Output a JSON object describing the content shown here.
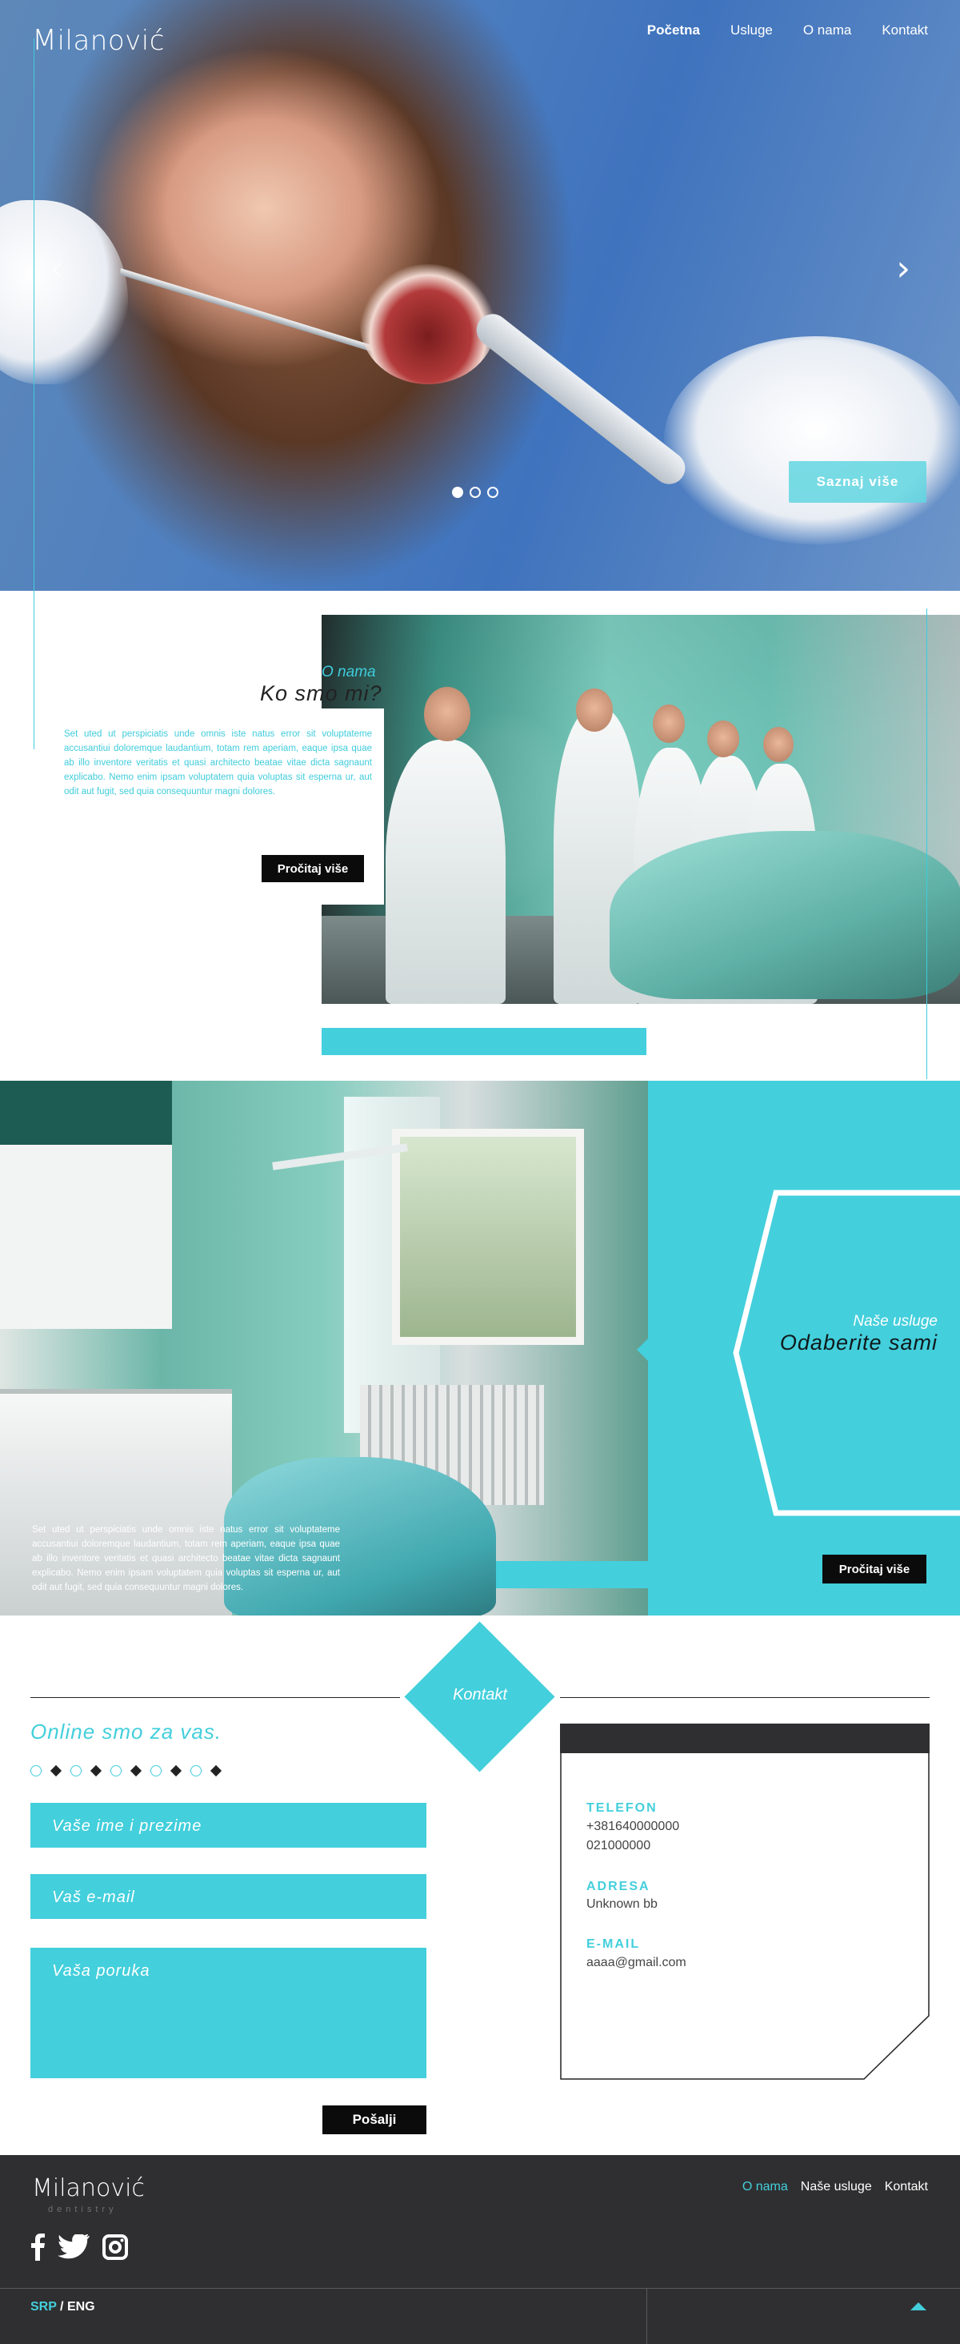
{
  "brand": {
    "logo_text": "ilanović",
    "logo_initial": "M",
    "tagline": "dentistry"
  },
  "nav": {
    "items": [
      "Početna",
      "Usluge",
      "O nama",
      "Kontakt"
    ],
    "active": "Početna"
  },
  "hero": {
    "prev_arrow": "‹",
    "next_arrow": "›",
    "cta": "Saznaj više",
    "slides": 3,
    "active_slide": 1
  },
  "about": {
    "subtitle": "O nama",
    "title": "Ko smo mi?",
    "text": "Set uted ut perspiciatis unde omnis iste natus error sit voluptateme accusantiui doloremque laudantium, totam rem aperiam, eaque ipsa quae ab illo inventore veritatis et quasi architecto beatae vitae dicta sagnaunt explicabo. Nemo enim ipsam voluptatem quia voluptas sit esperna ur, aut odit aut fugit, sed quia consequuntur magni dolores.",
    "button": "Pročitaj više"
  },
  "services": {
    "subtitle": "Naše usluge",
    "title": "Odaberite sami",
    "text": "Set uted ut perspiciatis unde omnis iste natus error sit voluptateme accusantiui doloremque laudantium, totam rem aperiam, eaque ipsa quae ab illo inventore veritatis et quasi architecto beatae vitae dicta sagnaunt explicabo. Nemo enim ipsam voluptatem quia voluptas sit esperna ur, aut odit aut fugit, sed quia consequuntur magni dolores.",
    "button": "Pročitaj više"
  },
  "contact": {
    "heading": "Kontakt",
    "online": "Online smo za vas.",
    "form": {
      "name_placeholder": "Vaše ime i prezime",
      "email_placeholder": "Vaš e-mail",
      "message_placeholder": "Vaša poruka",
      "send": "Pošalji"
    },
    "card": {
      "phone_label": "TELEFON",
      "phone_1": "+381640000000",
      "phone_2": "021000000",
      "address_label": "ADRESA",
      "address": "Unknown bb",
      "email_label": "E-MAIL",
      "email": "aaaa@gmail.com"
    }
  },
  "footer": {
    "nav": [
      "O nama",
      "Naše usluge",
      "Kontakt"
    ],
    "active": "O nama",
    "social": [
      "facebook-icon",
      "twitter-icon",
      "instagram-icon"
    ],
    "lang_active": "SRP",
    "lang_sep": " / ",
    "lang_other": "ENG"
  },
  "colors": {
    "accent": "#43cfdc",
    "dark": "#2f2f31",
    "black": "#0b0b0b"
  }
}
